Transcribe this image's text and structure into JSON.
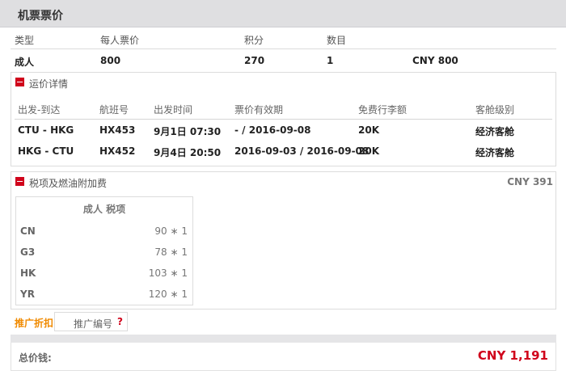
{
  "header": {
    "title": "机票票价"
  },
  "summary": {
    "headers": [
      "类型",
      "每人票价",
      "积分",
      "数目"
    ],
    "row": {
      "type": "成人",
      "price": "800",
      "points": "270",
      "count": "1",
      "total": "CNY 800"
    }
  },
  "fare_details": {
    "title": "运价详情",
    "columns": [
      "出发-到达",
      "航班号",
      "出发时间",
      "票价有效期",
      "免费行李额",
      "客舱级别"
    ],
    "rows": [
      {
        "route": "CTU - HKG",
        "flight": "HX453",
        "time": "9月1日 07:30",
        "validity": "- / 2016-09-08",
        "baggage": "20K",
        "cabin": "经济客舱"
      },
      {
        "route": "HKG - CTU",
        "flight": "HX452",
        "time": "9月4日 20:50",
        "validity": "2016-09-03 / 2016-09-08",
        "baggage": "20K",
        "cabin": "经济客舱"
      }
    ]
  },
  "taxes": {
    "title": "税项及燃油附加费",
    "total": "CNY 391",
    "box_header": "成人 税项",
    "items": [
      {
        "code": "CN",
        "value": "90 ∗ 1"
      },
      {
        "code": "G3",
        "value": "78 ∗ 1"
      },
      {
        "code": "HK",
        "value": "103 ∗ 1"
      },
      {
        "code": "YR",
        "value": "120 ∗ 1"
      }
    ]
  },
  "promo": {
    "label": "推广折扣",
    "placeholder": "推广编号",
    "help": "?"
  },
  "total": {
    "label": "总价钱:",
    "value": "CNY 1,191"
  },
  "colors": {
    "accent_red": "#d0021b",
    "promo_orange": "#f08a00",
    "header_bg": "#dfdfe1"
  }
}
